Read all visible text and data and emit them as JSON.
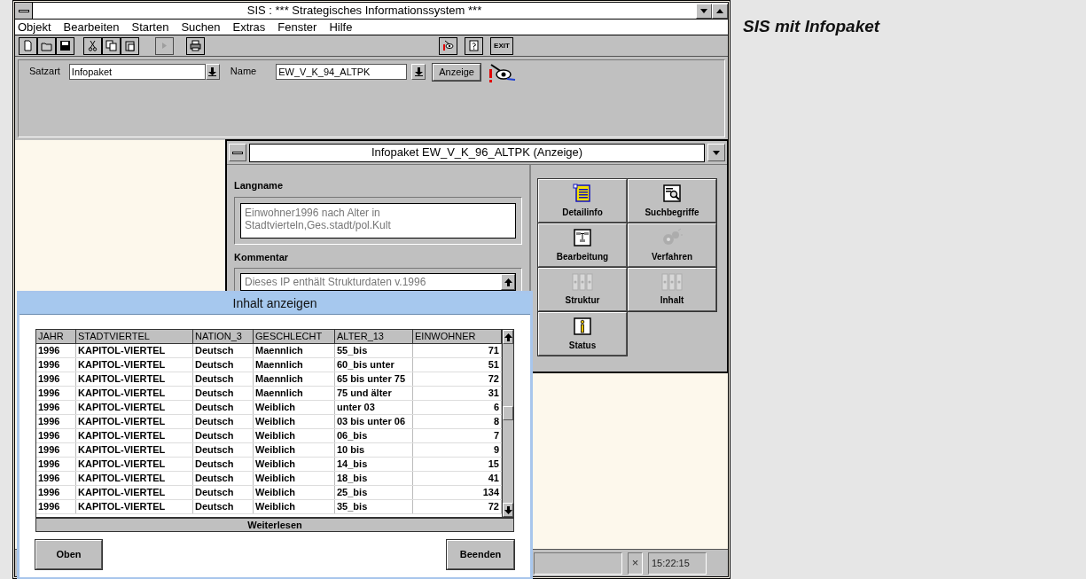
{
  "main_window": {
    "title": "SIS : *** Strategisches Informationssystem ***",
    "menu": [
      "Objekt",
      "Bearbeiten",
      "Starten",
      "Suchen",
      "Extras",
      "Fenster",
      "Hilfe"
    ],
    "toolbar": {
      "exit_button": "EXIT",
      "forward_enabled": false
    },
    "search": {
      "satzart_label": "Satzart",
      "satzart_value": "Infopaket",
      "name_label": "Name",
      "name_value": "EW_V_K_94_ALTPK",
      "show_button": "Anzeige"
    },
    "status_bar": {
      "close_mark": "×",
      "time": "15:22:15"
    }
  },
  "infopaket_window": {
    "title": "Infopaket EW_V_K_96_ALTPK (Anzeige)",
    "langname_label": "Langname",
    "langname_value": "Einwohner1996 nach Alter in Stadtvierteln,Ges.stadt/pol.Kult",
    "kommentar_label": "Kommentar",
    "kommentar_value": "Dieses IP enthält Strukturdaten v.1996",
    "buttons": [
      {
        "label": "Detailinfo",
        "kind": "list",
        "enabled": true
      },
      {
        "label": "Suchbegriffe",
        "kind": "search",
        "enabled": true
      },
      {
        "label": "Bearbeitung",
        "kind": "tree",
        "enabled": true
      },
      {
        "label": "Verfahren",
        "kind": "gears",
        "enabled": false
      },
      {
        "label": "Struktur",
        "kind": "binders",
        "enabled": false
      },
      {
        "label": "Inhalt",
        "kind": "binders",
        "enabled": false
      },
      {
        "label": "Status",
        "kind": "info",
        "enabled": true
      }
    ]
  },
  "dialog": {
    "title": "Inhalt anzeigen",
    "table": {
      "columns": [
        "JAHR",
        "STADTVIERTEL",
        "NATION_3",
        "GESCHLECHT",
        "ALTER_13",
        "EINWOHNER"
      ],
      "rows": [
        [
          "1996",
          "KAPITOL-VIERTEL",
          "Deutsch",
          "Maennlich",
          "55_bis",
          "71"
        ],
        [
          "1996",
          "KAPITOL-VIERTEL",
          "Deutsch",
          "Maennlich",
          "60_bis unter",
          "51"
        ],
        [
          "1996",
          "KAPITOL-VIERTEL",
          "Deutsch",
          "Maennlich",
          "65 bis unter 75",
          "72"
        ],
        [
          "1996",
          "KAPITOL-VIERTEL",
          "Deutsch",
          "Maennlich",
          "75 und älter",
          "31"
        ],
        [
          "1996",
          "KAPITOL-VIERTEL",
          "Deutsch",
          "Weiblich",
          "unter 03",
          "6"
        ],
        [
          "1996",
          "KAPITOL-VIERTEL",
          "Deutsch",
          "Weiblich",
          "03 bis unter 06",
          "8"
        ],
        [
          "1996",
          "KAPITOL-VIERTEL",
          "Deutsch",
          "Weiblich",
          "06_bis",
          "7"
        ],
        [
          "1996",
          "KAPITOL-VIERTEL",
          "Deutsch",
          "Weiblich",
          "10 bis",
          "9"
        ],
        [
          "1996",
          "KAPITOL-VIERTEL",
          "Deutsch",
          "Weiblich",
          "14_bis",
          "15"
        ],
        [
          "1996",
          "KAPITOL-VIERTEL",
          "Deutsch",
          "Weiblich",
          "18_bis",
          "41"
        ],
        [
          "1996",
          "KAPITOL-VIERTEL",
          "Deutsch",
          "Weiblich",
          "25_bis",
          "134"
        ],
        [
          "1996",
          "KAPITOL-VIERTEL",
          "Deutsch",
          "Weiblich",
          "35_bis",
          "72"
        ]
      ]
    },
    "more_button": "Weiterlesen",
    "top_button": "Oben",
    "close_button": "Beenden"
  },
  "caption": "SIS mit Infopaket"
}
